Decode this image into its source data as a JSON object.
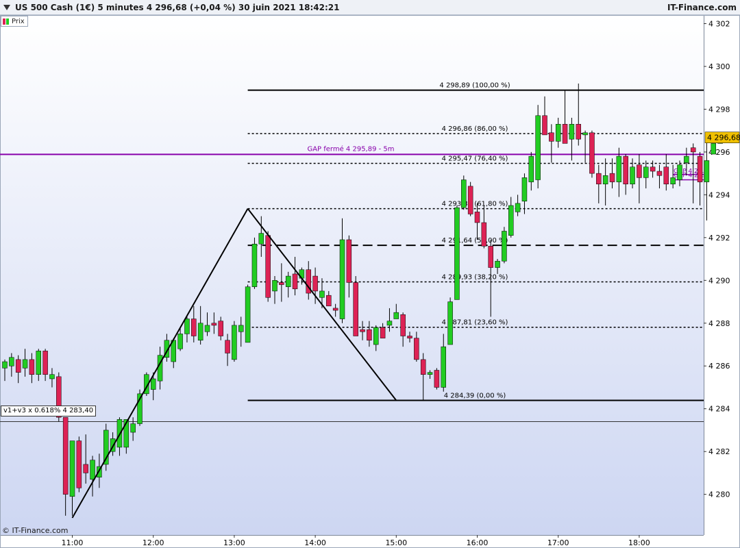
{
  "header": {
    "title": "US 500 Cash (1€) 5 minutes 4 296,68 (+0,04 %) 30 juin 2021 18:42:21",
    "brand": "IT-Finance.com"
  },
  "legend": {
    "label": "Prix"
  },
  "footer": {
    "copyright": "© IT-Finance.com"
  },
  "indicator_label": "v1+v3 x 0.618% 4 283,40",
  "colors": {
    "up": "#22cc22",
    "down": "#dd2255",
    "gap_line": "#8800aa",
    "price_tag": "#f0c000",
    "bg_top": "#ffffff",
    "bg_bottom": "#cdd6f2"
  },
  "chart_data": {
    "type": "candlestick",
    "timeframe": "5 minutes",
    "ylim": [
      4278.1,
      4302.4
    ],
    "y_ticks": [
      "4 302",
      "4 300",
      "4 298",
      "4 296",
      "4 294",
      "4 292",
      "4 290",
      "4 288",
      "4 286",
      "4 284",
      "4 282",
      "4 280"
    ],
    "y_tick_values": [
      4302,
      4300,
      4298,
      4296,
      4294,
      4292,
      4290,
      4288,
      4286,
      4284,
      4282,
      4280
    ],
    "x_ticks": [
      "11:00",
      "12:00",
      "13:00",
      "14:00",
      "15:00",
      "16:00",
      "17:00",
      "18:00"
    ],
    "x_tick_index": [
      10,
      22,
      34,
      46,
      58,
      70,
      82,
      94
    ],
    "last_price": "4 296,68",
    "last_price_value": 4296.68,
    "candles": [
      {
        "o": 4285.9,
        "h": 4286.3,
        "l": 4285.3,
        "c": 4286.2
      },
      {
        "o": 4286.0,
        "h": 4286.6,
        "l": 4285.5,
        "c": 4286.4
      },
      {
        "o": 4286.3,
        "h": 4286.5,
        "l": 4285.2,
        "c": 4285.7
      },
      {
        "o": 4285.9,
        "h": 4286.8,
        "l": 4285.5,
        "c": 4286.3
      },
      {
        "o": 4286.3,
        "h": 4286.6,
        "l": 4285.2,
        "c": 4285.6
      },
      {
        "o": 4285.6,
        "h": 4286.8,
        "l": 4285.3,
        "c": 4286.7
      },
      {
        "o": 4286.7,
        "h": 4286.8,
        "l": 4285.3,
        "c": 4285.6
      },
      {
        "o": 4285.4,
        "h": 4285.9,
        "l": 4285.0,
        "c": 4285.6
      },
      {
        "o": 4285.5,
        "h": 4285.7,
        "l": 4283.4,
        "c": 4283.6
      },
      {
        "o": 4283.6,
        "h": 4283.6,
        "l": 4279.0,
        "c": 4280.0
      },
      {
        "o": 4279.9,
        "h": 4282.5,
        "l": 4279.0,
        "c": 4282.5
      },
      {
        "o": 4282.5,
        "h": 4282.7,
        "l": 4280.1,
        "c": 4280.3
      },
      {
        "o": 4281.4,
        "h": 4282.8,
        "l": 4280.5,
        "c": 4281.0
      },
      {
        "o": 4280.7,
        "h": 4281.8,
        "l": 4279.9,
        "c": 4281.6
      },
      {
        "o": 4280.8,
        "h": 4281.9,
        "l": 4280.3,
        "c": 4281.3
      },
      {
        "o": 4281.4,
        "h": 4283.3,
        "l": 4281.1,
        "c": 4283.0
      },
      {
        "o": 4282.0,
        "h": 4282.9,
        "l": 4281.8,
        "c": 4282.6
      },
      {
        "o": 4282.2,
        "h": 4283.6,
        "l": 4281.8,
        "c": 4283.5
      },
      {
        "o": 4282.2,
        "h": 4283.5,
        "l": 4281.9,
        "c": 4283.5
      },
      {
        "o": 4282.9,
        "h": 4283.6,
        "l": 4282.5,
        "c": 4283.3
      },
      {
        "o": 4283.3,
        "h": 4284.9,
        "l": 4283.2,
        "c": 4284.7
      },
      {
        "o": 4284.7,
        "h": 4285.7,
        "l": 4284.6,
        "c": 4285.6
      },
      {
        "o": 4284.9,
        "h": 4285.7,
        "l": 4284.4,
        "c": 4285.4
      },
      {
        "o": 4285.3,
        "h": 4286.9,
        "l": 4284.9,
        "c": 4286.5
      },
      {
        "o": 4286.4,
        "h": 4287.5,
        "l": 4286.2,
        "c": 4287.2
      },
      {
        "o": 4286.2,
        "h": 4287.3,
        "l": 4285.9,
        "c": 4287.2
      },
      {
        "o": 4286.8,
        "h": 4287.8,
        "l": 4286.7,
        "c": 4287.5
      },
      {
        "o": 4287.5,
        "h": 4288.3,
        "l": 4287.1,
        "c": 4288.2
      },
      {
        "o": 4288.2,
        "h": 4288.8,
        "l": 4287.1,
        "c": 4287.4
      },
      {
        "o": 4287.2,
        "h": 4288.8,
        "l": 4287.0,
        "c": 4288.0
      },
      {
        "o": 4287.6,
        "h": 4288.5,
        "l": 4287.4,
        "c": 4287.9
      },
      {
        "o": 4288.0,
        "h": 4288.5,
        "l": 4287.5,
        "c": 4287.9
      },
      {
        "o": 4288.1,
        "h": 4288.3,
        "l": 4287.2,
        "c": 4287.4
      },
      {
        "o": 4287.2,
        "h": 4287.5,
        "l": 4286.0,
        "c": 4286.6
      },
      {
        "o": 4286.3,
        "h": 4288.1,
        "l": 4286.2,
        "c": 4287.9
      },
      {
        "o": 4287.6,
        "h": 4288.3,
        "l": 4286.9,
        "c": 4287.9
      },
      {
        "o": 4287.1,
        "h": 4289.8,
        "l": 4287.1,
        "c": 4289.7
      },
      {
        "o": 4289.7,
        "h": 4292.0,
        "l": 4289.6,
        "c": 4291.7
      },
      {
        "o": 4291.7,
        "h": 4293.0,
        "l": 4291.1,
        "c": 4292.2
      },
      {
        "o": 4292.1,
        "h": 4292.3,
        "l": 4289.0,
        "c": 4289.2
      },
      {
        "o": 4289.5,
        "h": 4290.2,
        "l": 4288.9,
        "c": 4290.0
      },
      {
        "o": 4289.9,
        "h": 4290.8,
        "l": 4289.0,
        "c": 4289.8
      },
      {
        "o": 4289.7,
        "h": 4290.4,
        "l": 4289.2,
        "c": 4290.2
      },
      {
        "o": 4290.3,
        "h": 4291.1,
        "l": 4289.3,
        "c": 4289.6
      },
      {
        "o": 4290.1,
        "h": 4290.6,
        "l": 4289.8,
        "c": 4290.5
      },
      {
        "o": 4290.5,
        "h": 4290.9,
        "l": 4289.1,
        "c": 4289.4
      },
      {
        "o": 4290.2,
        "h": 4290.6,
        "l": 4288.9,
        "c": 4289.5
      },
      {
        "o": 4289.2,
        "h": 4290.1,
        "l": 4288.7,
        "c": 4289.5
      },
      {
        "o": 4289.3,
        "h": 4289.5,
        "l": 4288.8,
        "c": 4288.8
      },
      {
        "o": 4288.7,
        "h": 4288.9,
        "l": 4288.3,
        "c": 4288.6
      },
      {
        "o": 4288.2,
        "h": 4292.9,
        "l": 4288.0,
        "c": 4291.9
      },
      {
        "o": 4291.9,
        "h": 4292.1,
        "l": 4289.2,
        "c": 4289.9
      },
      {
        "o": 4289.9,
        "h": 4290.2,
        "l": 4287.4,
        "c": 4287.4
      },
      {
        "o": 4287.7,
        "h": 4288.1,
        "l": 4287.2,
        "c": 4287.6
      },
      {
        "o": 4287.7,
        "h": 4288.1,
        "l": 4286.9,
        "c": 4287.2
      },
      {
        "o": 4287.0,
        "h": 4287.9,
        "l": 4286.7,
        "c": 4287.8
      },
      {
        "o": 4287.8,
        "h": 4288.0,
        "l": 4287.3,
        "c": 4287.3
      },
      {
        "o": 4287.9,
        "h": 4288.7,
        "l": 4287.6,
        "c": 4288.1
      },
      {
        "o": 4288.2,
        "h": 4288.9,
        "l": 4288.2,
        "c": 4288.5
      },
      {
        "o": 4288.4,
        "h": 4288.5,
        "l": 4286.9,
        "c": 4287.4
      },
      {
        "o": 4287.4,
        "h": 4287.6,
        "l": 4287.1,
        "c": 4287.3
      },
      {
        "o": 4287.3,
        "h": 4287.6,
        "l": 4286.2,
        "c": 4286.3
      },
      {
        "o": 4286.3,
        "h": 4286.6,
        "l": 4284.4,
        "c": 4285.6
      },
      {
        "o": 4285.6,
        "h": 4285.8,
        "l": 4285.4,
        "c": 4285.7
      },
      {
        "o": 4285.8,
        "h": 4285.9,
        "l": 4284.9,
        "c": 4285.0
      },
      {
        "o": 4285.0,
        "h": 4287.5,
        "l": 4284.8,
        "c": 4286.9
      },
      {
        "o": 4287.0,
        "h": 4289.2,
        "l": 4287.0,
        "c": 4289.0
      },
      {
        "o": 4289.1,
        "h": 4293.5,
        "l": 4289.1,
        "c": 4293.4
      },
      {
        "o": 4293.4,
        "h": 4294.9,
        "l": 4293.3,
        "c": 4294.7
      },
      {
        "o": 4294.4,
        "h": 4294.6,
        "l": 4293.0,
        "c": 4293.1
      },
      {
        "o": 4293.2,
        "h": 4293.6,
        "l": 4291.9,
        "c": 4292.7
      },
      {
        "o": 4292.7,
        "h": 4293.5,
        "l": 4291.5,
        "c": 4291.6
      },
      {
        "o": 4291.6,
        "h": 4291.9,
        "l": 4288.3,
        "c": 4290.6
      },
      {
        "o": 4290.6,
        "h": 4291.0,
        "l": 4290.3,
        "c": 4290.9
      },
      {
        "o": 4290.9,
        "h": 4292.5,
        "l": 4290.8,
        "c": 4292.3
      },
      {
        "o": 4292.1,
        "h": 4293.9,
        "l": 4292.0,
        "c": 4293.5
      },
      {
        "o": 4293.2,
        "h": 4294.0,
        "l": 4293.0,
        "c": 4293.6
      },
      {
        "o": 4293.7,
        "h": 4295.0,
        "l": 4293.1,
        "c": 4294.8
      },
      {
        "o": 4294.6,
        "h": 4296.0,
        "l": 4294.2,
        "c": 4295.8
      },
      {
        "o": 4294.7,
        "h": 4298.2,
        "l": 4294.3,
        "c": 4297.7
      },
      {
        "o": 4297.7,
        "h": 4298.6,
        "l": 4296.9,
        "c": 4296.8
      },
      {
        "o": 4296.9,
        "h": 4297.3,
        "l": 4295.5,
        "c": 4296.5
      },
      {
        "o": 4296.5,
        "h": 4297.6,
        "l": 4296.2,
        "c": 4297.3
      },
      {
        "o": 4297.3,
        "h": 4298.9,
        "l": 4296.6,
        "c": 4296.4
      },
      {
        "o": 4296.6,
        "h": 4297.6,
        "l": 4295.6,
        "c": 4297.3
      },
      {
        "o": 4297.3,
        "h": 4299.2,
        "l": 4296.3,
        "c": 4296.6
      },
      {
        "o": 4296.8,
        "h": 4297.0,
        "l": 4295.5,
        "c": 4296.9
      },
      {
        "o": 4296.9,
        "h": 4297.0,
        "l": 4294.8,
        "c": 4295.0
      },
      {
        "o": 4295.0,
        "h": 4295.4,
        "l": 4293.6,
        "c": 4294.5
      },
      {
        "o": 4294.5,
        "h": 4295.7,
        "l": 4293.5,
        "c": 4294.9
      },
      {
        "o": 4295.0,
        "h": 4295.7,
        "l": 4294.3,
        "c": 4294.6
      },
      {
        "o": 4294.6,
        "h": 4296.2,
        "l": 4293.9,
        "c": 4295.8
      },
      {
        "o": 4295.8,
        "h": 4295.9,
        "l": 4294.0,
        "c": 4294.5
      },
      {
        "o": 4294.5,
        "h": 4295.7,
        "l": 4294.3,
        "c": 4295.3
      },
      {
        "o": 4295.4,
        "h": 4295.9,
        "l": 4293.6,
        "c": 4294.8
      },
      {
        "o": 4294.8,
        "h": 4295.6,
        "l": 4294.3,
        "c": 4295.3
      },
      {
        "o": 4295.3,
        "h": 4295.6,
        "l": 4294.8,
        "c": 4295.1
      },
      {
        "o": 4295.1,
        "h": 4295.4,
        "l": 4294.3,
        "c": 4294.9
      },
      {
        "o": 4295.3,
        "h": 4295.9,
        "l": 4294.2,
        "c": 4294.5
      },
      {
        "o": 4294.5,
        "h": 4295.4,
        "l": 4294.3,
        "c": 4294.8
      },
      {
        "o": 4294.7,
        "h": 4295.6,
        "l": 4294.4,
        "c": 4295.4
      },
      {
        "o": 4295.5,
        "h": 4296.2,
        "l": 4294.9,
        "c": 4295.8
      },
      {
        "o": 4296.2,
        "h": 4296.4,
        "l": 4293.6,
        "c": 4296.0
      },
      {
        "o": 4295.8,
        "h": 4296.0,
        "l": 4293.5,
        "c": 4294.6
      },
      {
        "o": 4294.6,
        "h": 4296.8,
        "l": 4292.8,
        "c": 4295.6
      },
      {
        "o": 4295.9,
        "h": 4296.2,
        "l": 4295.9,
        "c": 4296.4
      },
      {
        "o": 4296.4,
        "h": 4296.7,
        "l": 4296.4,
        "c": 4296.68
      }
    ],
    "fibonacci": {
      "levels": [
        {
          "value": 4298.89,
          "label": "4 298,89 (100,00 %)",
          "style": "solid"
        },
        {
          "value": 4296.86,
          "label": "4 296,86 (86,00 %)",
          "style": "dotted"
        },
        {
          "value": 4295.47,
          "label": "4 295,47 (76,40 %)",
          "style": "dotted"
        },
        {
          "value": 4293.35,
          "label": "4 293,35 (61,80 %)",
          "style": "dotted"
        },
        {
          "value": 4291.64,
          "label": "4 291,64 (50,00 %)",
          "style": "dashed"
        },
        {
          "value": 4289.93,
          "label": "4 289,93 (38,20 %)",
          "style": "dotted"
        },
        {
          "value": 4287.81,
          "label": "4 287,81 (23,60 %)",
          "style": "dotted"
        },
        {
          "value": 4284.39,
          "label": "4 284,39 (0,00 %)",
          "style": "solid"
        }
      ]
    },
    "gap_line": {
      "value": 4295.89,
      "label": "GAP fermé 4 295,89 - 5m"
    },
    "gap_small": [
      {
        "value": 4294.95,
        "label": "GAP 4 2..."
      },
      {
        "value": 4294.7,
        "label": "GAP 4 2..."
      }
    ],
    "indicator_line": {
      "value": 4283.4
    },
    "trendlines": [
      {
        "from_index": 10,
        "from_value": 4278.9,
        "to_index": 36,
        "to_value": 4293.35
      },
      {
        "from_index": 36,
        "from_value": 4293.35,
        "to_index": 58,
        "to_value": 4284.39
      }
    ]
  }
}
